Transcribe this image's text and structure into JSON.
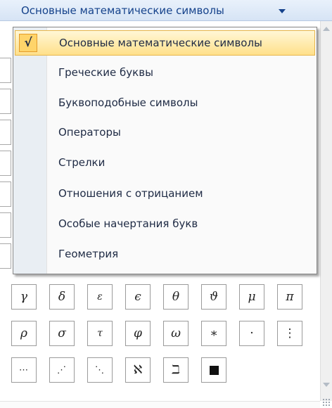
{
  "header": {
    "label": "Основные математические символы"
  },
  "menu": {
    "check_mark": "√",
    "items": [
      {
        "label": "Основные математические символы",
        "selected": true
      },
      {
        "label": "Греческие буквы"
      },
      {
        "label": "Буквоподобные символы"
      },
      {
        "label": "Операторы"
      },
      {
        "label": "Стрелки"
      },
      {
        "label": "Отношения с отрицанием"
      },
      {
        "label": "Особые начертания букв"
      },
      {
        "label": "Геометрия"
      }
    ]
  },
  "symbols": {
    "row1": [
      "γ",
      "δ",
      "ε",
      "ϵ",
      "θ",
      "ϑ",
      "μ",
      "π"
    ],
    "row2": [
      "ρ",
      "σ",
      "τ",
      "φ",
      "ω",
      "∗",
      "·",
      "⋮"
    ],
    "row3": [
      "⋯",
      "⋰",
      "⋱",
      "ℵ",
      "ℶ",
      "black-square-icon"
    ]
  }
}
